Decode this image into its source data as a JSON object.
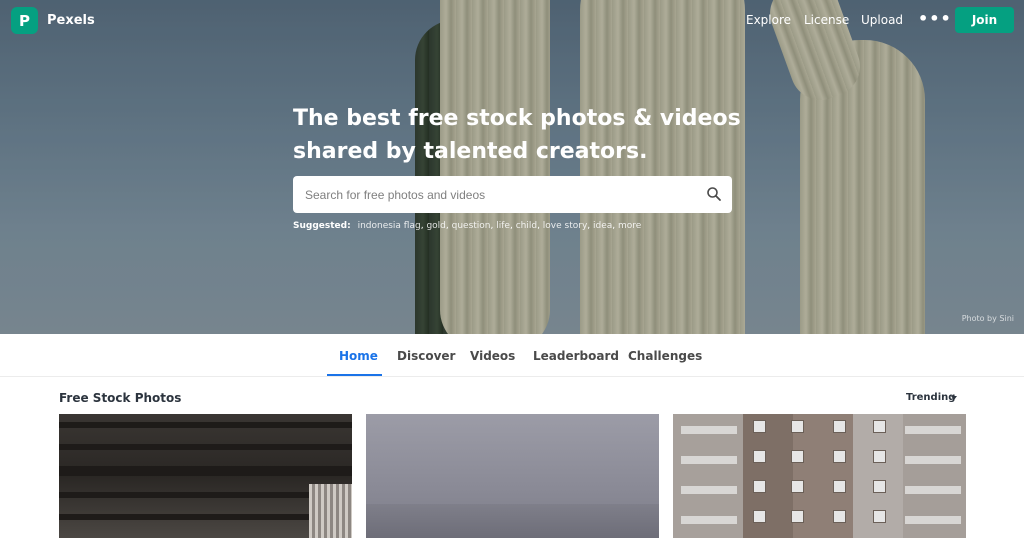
{
  "brand": {
    "name": "Pexels",
    "logo_letter": "P"
  },
  "nav": {
    "links": [
      "Explore",
      "License",
      "Upload"
    ],
    "more_label": "•••",
    "join_label": "Join"
  },
  "hero": {
    "headline_line1": "The best free stock photos & videos",
    "headline_line2": "shared by talented creators.",
    "search_placeholder": "Search for free photos and videos",
    "suggested_label": "Suggested:",
    "suggested_tags": [
      "indonesia flag",
      "gold",
      "question",
      "life",
      "child",
      "love story",
      "idea",
      "more"
    ],
    "photo_credit": "Photo by Sini"
  },
  "tabs": [
    {
      "label": "Home",
      "active": true
    },
    {
      "label": "Discover",
      "active": false
    },
    {
      "label": "Videos",
      "active": false
    },
    {
      "label": "Leaderboard",
      "active": false
    },
    {
      "label": "Challenges",
      "active": false
    }
  ],
  "section": {
    "title": "Free Stock Photos",
    "sort_label": "Trending"
  },
  "colors": {
    "brand": "#05a081",
    "tab_active": "#1a73e8"
  }
}
